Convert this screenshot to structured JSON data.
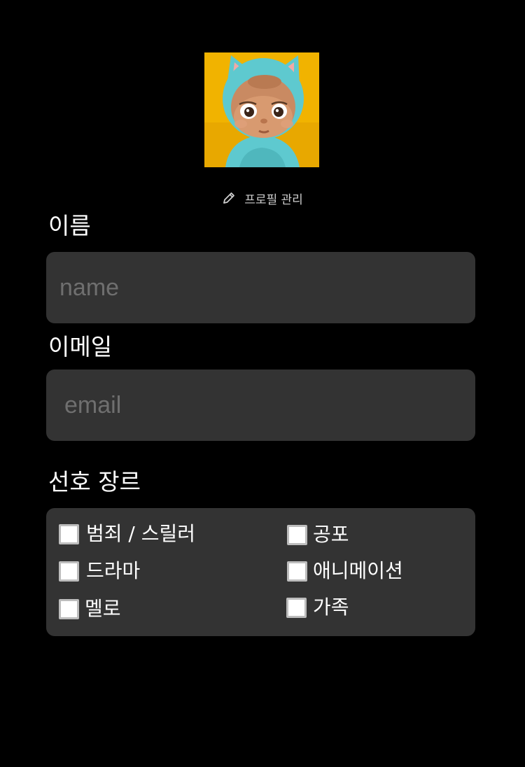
{
  "profile": {
    "avatar_icon": "baby-in-cat-hood-avatar",
    "edit_icon": "pencil-icon",
    "manage_label": "프로필 관리"
  },
  "form": {
    "name": {
      "label": "이름",
      "value": "",
      "placeholder": "name"
    },
    "email": {
      "label": "이메일",
      "value": "",
      "placeholder": "email"
    }
  },
  "genres": {
    "label": "선호 장르",
    "items": [
      {
        "label": "범죄 / 스릴러",
        "checked": false
      },
      {
        "label": "공포",
        "checked": false
      },
      {
        "label": "드라마",
        "checked": false
      },
      {
        "label": "애니메이션",
        "checked": false
      },
      {
        "label": "멜로",
        "checked": false
      },
      {
        "label": "가족",
        "checked": false
      }
    ]
  },
  "colors": {
    "background": "#000000",
    "field_background": "#333333",
    "placeholder": "#6f6f6f",
    "text": "#ffffff",
    "muted_text": "#cfcfcf",
    "avatar_background": "#f0b400",
    "hood": "#5ec9cf"
  }
}
